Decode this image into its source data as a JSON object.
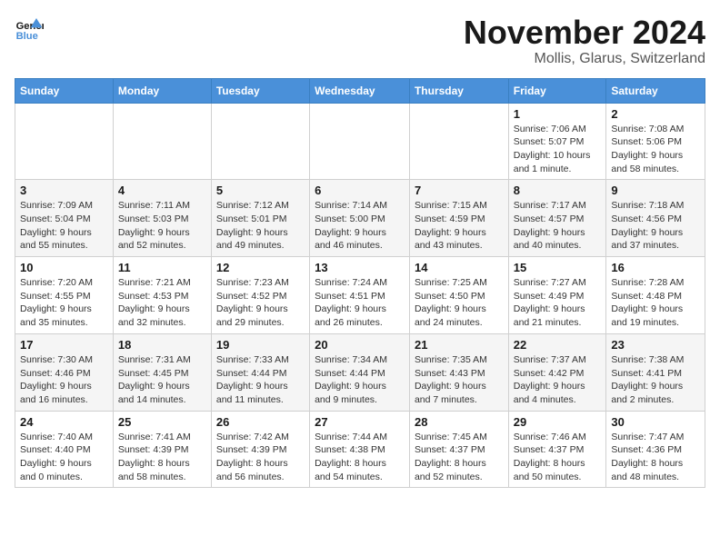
{
  "header": {
    "logo_line1": "General",
    "logo_line2": "Blue",
    "month": "November 2024",
    "location": "Mollis, Glarus, Switzerland"
  },
  "weekdays": [
    "Sunday",
    "Monday",
    "Tuesday",
    "Wednesday",
    "Thursday",
    "Friday",
    "Saturday"
  ],
  "weeks": [
    [
      {
        "day": "",
        "info": ""
      },
      {
        "day": "",
        "info": ""
      },
      {
        "day": "",
        "info": ""
      },
      {
        "day": "",
        "info": ""
      },
      {
        "day": "",
        "info": ""
      },
      {
        "day": "1",
        "info": "Sunrise: 7:06 AM\nSunset: 5:07 PM\nDaylight: 10 hours and 1 minute."
      },
      {
        "day": "2",
        "info": "Sunrise: 7:08 AM\nSunset: 5:06 PM\nDaylight: 9 hours and 58 minutes."
      }
    ],
    [
      {
        "day": "3",
        "info": "Sunrise: 7:09 AM\nSunset: 5:04 PM\nDaylight: 9 hours and 55 minutes."
      },
      {
        "day": "4",
        "info": "Sunrise: 7:11 AM\nSunset: 5:03 PM\nDaylight: 9 hours and 52 minutes."
      },
      {
        "day": "5",
        "info": "Sunrise: 7:12 AM\nSunset: 5:01 PM\nDaylight: 9 hours and 49 minutes."
      },
      {
        "day": "6",
        "info": "Sunrise: 7:14 AM\nSunset: 5:00 PM\nDaylight: 9 hours and 46 minutes."
      },
      {
        "day": "7",
        "info": "Sunrise: 7:15 AM\nSunset: 4:59 PM\nDaylight: 9 hours and 43 minutes."
      },
      {
        "day": "8",
        "info": "Sunrise: 7:17 AM\nSunset: 4:57 PM\nDaylight: 9 hours and 40 minutes."
      },
      {
        "day": "9",
        "info": "Sunrise: 7:18 AM\nSunset: 4:56 PM\nDaylight: 9 hours and 37 minutes."
      }
    ],
    [
      {
        "day": "10",
        "info": "Sunrise: 7:20 AM\nSunset: 4:55 PM\nDaylight: 9 hours and 35 minutes."
      },
      {
        "day": "11",
        "info": "Sunrise: 7:21 AM\nSunset: 4:53 PM\nDaylight: 9 hours and 32 minutes."
      },
      {
        "day": "12",
        "info": "Sunrise: 7:23 AM\nSunset: 4:52 PM\nDaylight: 9 hours and 29 minutes."
      },
      {
        "day": "13",
        "info": "Sunrise: 7:24 AM\nSunset: 4:51 PM\nDaylight: 9 hours and 26 minutes."
      },
      {
        "day": "14",
        "info": "Sunrise: 7:25 AM\nSunset: 4:50 PM\nDaylight: 9 hours and 24 minutes."
      },
      {
        "day": "15",
        "info": "Sunrise: 7:27 AM\nSunset: 4:49 PM\nDaylight: 9 hours and 21 minutes."
      },
      {
        "day": "16",
        "info": "Sunrise: 7:28 AM\nSunset: 4:48 PM\nDaylight: 9 hours and 19 minutes."
      }
    ],
    [
      {
        "day": "17",
        "info": "Sunrise: 7:30 AM\nSunset: 4:46 PM\nDaylight: 9 hours and 16 minutes."
      },
      {
        "day": "18",
        "info": "Sunrise: 7:31 AM\nSunset: 4:45 PM\nDaylight: 9 hours and 14 minutes."
      },
      {
        "day": "19",
        "info": "Sunrise: 7:33 AM\nSunset: 4:44 PM\nDaylight: 9 hours and 11 minutes."
      },
      {
        "day": "20",
        "info": "Sunrise: 7:34 AM\nSunset: 4:44 PM\nDaylight: 9 hours and 9 minutes."
      },
      {
        "day": "21",
        "info": "Sunrise: 7:35 AM\nSunset: 4:43 PM\nDaylight: 9 hours and 7 minutes."
      },
      {
        "day": "22",
        "info": "Sunrise: 7:37 AM\nSunset: 4:42 PM\nDaylight: 9 hours and 4 minutes."
      },
      {
        "day": "23",
        "info": "Sunrise: 7:38 AM\nSunset: 4:41 PM\nDaylight: 9 hours and 2 minutes."
      }
    ],
    [
      {
        "day": "24",
        "info": "Sunrise: 7:40 AM\nSunset: 4:40 PM\nDaylight: 9 hours and 0 minutes."
      },
      {
        "day": "25",
        "info": "Sunrise: 7:41 AM\nSunset: 4:39 PM\nDaylight: 8 hours and 58 minutes."
      },
      {
        "day": "26",
        "info": "Sunrise: 7:42 AM\nSunset: 4:39 PM\nDaylight: 8 hours and 56 minutes."
      },
      {
        "day": "27",
        "info": "Sunrise: 7:44 AM\nSunset: 4:38 PM\nDaylight: 8 hours and 54 minutes."
      },
      {
        "day": "28",
        "info": "Sunrise: 7:45 AM\nSunset: 4:37 PM\nDaylight: 8 hours and 52 minutes."
      },
      {
        "day": "29",
        "info": "Sunrise: 7:46 AM\nSunset: 4:37 PM\nDaylight: 8 hours and 50 minutes."
      },
      {
        "day": "30",
        "info": "Sunrise: 7:47 AM\nSunset: 4:36 PM\nDaylight: 8 hours and 48 minutes."
      }
    ]
  ]
}
